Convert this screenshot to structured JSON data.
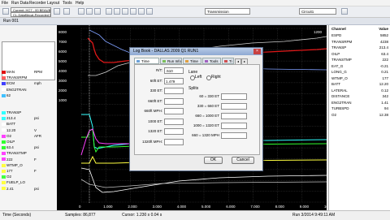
{
  "menu": [
    "File",
    "Run Data",
    "Recorder",
    "Layout",
    "Tools",
    "Help"
  ],
  "toolbar": {
    "selectors": [
      "Current: HC7 - 00 BEAUBIT",
      "CL-Datafilecat-Recorded Run"
    ],
    "session_select": "Transmission",
    "layout_select": "Circuit1"
  },
  "tabbar": {
    "run_label": "Run 001"
  },
  "left_channels": [
    {
      "label": "MAN",
      "unit": "RPM",
      "color": "#e01010"
    },
    {
      "label": "TRANSRPM",
      "unit": "",
      "color": "#ff6060"
    },
    {
      "label": "ECM",
      "unit": "mph",
      "color": "#4040ff"
    },
    {
      "label": "ENG2TRAN",
      "unit": "",
      "color": "#ffffff"
    },
    {
      "label": "62",
      "unit": "",
      "color": "#40c0ff"
    }
  ],
  "left_channels_lower": [
    {
      "label": "TRANSP",
      "unit": "",
      "color": "#30ffff"
    },
    {
      "label": "213.4",
      "unit": "psi",
      "color": "#30ffff"
    },
    {
      "label": "BATT",
      "unit": "",
      "color": "#ffffff"
    },
    {
      "label": "12.20",
      "unit": "V",
      "color": "#ffffff"
    },
    {
      "label": "O2",
      "unit": "AFR",
      "color": "#ff40ff"
    },
    {
      "label": "OILP",
      "unit": "",
      "color": "#30ff30"
    },
    {
      "label": "63.4",
      "unit": "psi",
      "color": "#30ff30"
    },
    {
      "label": "TRANSTMP",
      "unit": "",
      "color": "#ff40ff"
    },
    {
      "label": "222",
      "unit": "F",
      "color": "#ff40ff"
    },
    {
      "label": "WTMP_O",
      "unit": "",
      "color": "#ffff40"
    },
    {
      "label": "177",
      "unit": "F",
      "color": "#ffff40"
    },
    {
      "label": "O2",
      "unit": "",
      "color": "#40ff40"
    },
    {
      "label": "FUELP_LO",
      "unit": "",
      "color": "#ffff40"
    },
    {
      "label": "2.41",
      "unit": "psi",
      "color": "#ffff40"
    }
  ],
  "right_panel": {
    "header": [
      "Channel",
      "Value"
    ],
    "rows": [
      {
        "name": "ESPD",
        "value": "5852"
      },
      {
        "name": "TRANSRPM",
        "value": "4238"
      },
      {
        "name": "TRANSP",
        "value": "213.4"
      },
      {
        "name": "OILP",
        "value": "63.4"
      },
      {
        "name": "TRANSTMP",
        "value": "222"
      },
      {
        "name": "EAT_G",
        "value": "-0.21"
      },
      {
        "name": "LONG_G",
        "value": "0.21"
      },
      {
        "name": "WTMP_O",
        "value": "177"
      },
      {
        "name": "BATT",
        "value": "12.20"
      },
      {
        "name": "LATERAL",
        "value": "0.12"
      },
      {
        "name": "DISTANCE",
        "value": "342"
      },
      {
        "name": "ENG2TRAN",
        "value": "1.41"
      },
      {
        "name": "TURBSPD",
        "value": "94"
      },
      {
        "name": "O2",
        "value": "12.38"
      }
    ]
  },
  "chart": {
    "y_ticks": [
      "8000",
      "7000",
      "6000",
      "5000",
      "4000",
      "3000",
      "2000",
      "1000"
    ],
    "x_ticks": [
      "0",
      "1.000",
      "2.000",
      "3.000",
      "4.000",
      "5.000",
      "6.000",
      "7.000",
      "8.000",
      "9.000",
      "10.000"
    ],
    "top_right_tick": "1200"
  },
  "dialog": {
    "title": "Log Book - DALLAS 2009 Q1 RUN1",
    "tabs": [
      "Time Sheet",
      "Run Info",
      "Time",
      "Tools",
      "Ti"
    ],
    "left_fields": [
      {
        "label": "R/T:",
        "value": ".510"
      },
      {
        "label": "60ft ET:",
        "value": "1.479"
      },
      {
        "label": "330 ET:",
        "value": ""
      },
      {
        "label": "660ft ET:",
        "value": ""
      },
      {
        "label": "660ft MPH:",
        "value": ""
      },
      {
        "label": "1000 ET:",
        "value": ""
      },
      {
        "label": "1320 ET:",
        "value": ""
      },
      {
        "label": "1320ft MPH:",
        "value": ""
      }
    ],
    "lane": {
      "group_label": "Lane",
      "options": [
        "Left",
        "Right"
      ]
    },
    "splits": {
      "label": "Splits",
      "rows": [
        "60 = 330 ET",
        "330 = 660 ET",
        "660 = 1000 ET",
        "1000 = 1320 ET",
        "660 = 1320 MPH"
      ]
    },
    "ok_label": "OK",
    "cancel_label": "Cancel"
  },
  "status": {
    "left": "Time (Seconds)",
    "mid1": "Samples: 86,877",
    "mid2": "Cursor: 1.230 s    0.04 s",
    "right": "Run 3/2014 9:49:11 AM"
  }
}
